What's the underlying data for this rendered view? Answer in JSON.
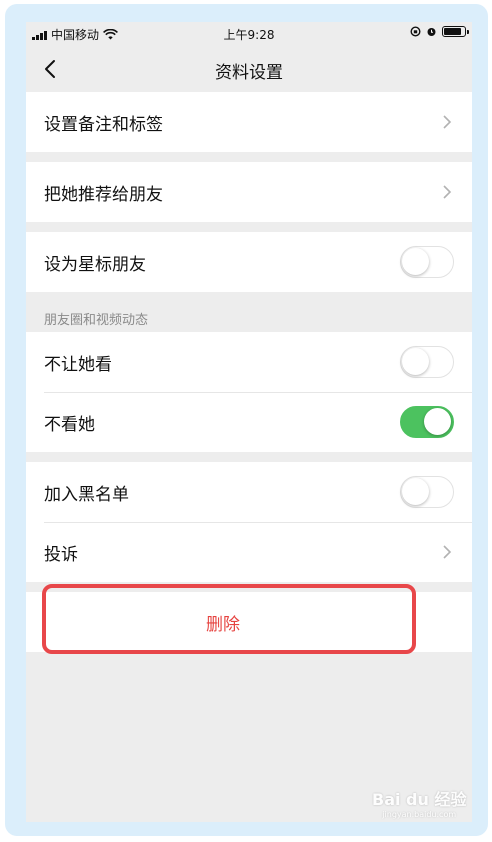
{
  "status_bar": {
    "carrier": "中国移动",
    "time": "上午9:28"
  },
  "nav": {
    "title": "资料设置"
  },
  "group1": {
    "remark_label": "设置备注和标签"
  },
  "group2": {
    "recommend_label": "把她推荐给朋友"
  },
  "group3": {
    "star_label": "设为星标朋友",
    "star_on": false
  },
  "moments": {
    "header": "朋友圈和视频动态",
    "hide_mine_label": "不让她看",
    "hide_mine_on": false,
    "hide_hers_label": "不看她",
    "hide_hers_on": true
  },
  "group4": {
    "blacklist_label": "加入黑名单",
    "blacklist_on": false,
    "complain_label": "投诉"
  },
  "delete": {
    "label": "删除"
  },
  "watermark": {
    "brand": "Bai du 经验",
    "url": "jingyan.baidu.com"
  },
  "colors": {
    "toggle_on": "#4cc25f",
    "delete_text": "#e64340",
    "highlight": "#e8474a",
    "frame": "#dbeefb"
  }
}
